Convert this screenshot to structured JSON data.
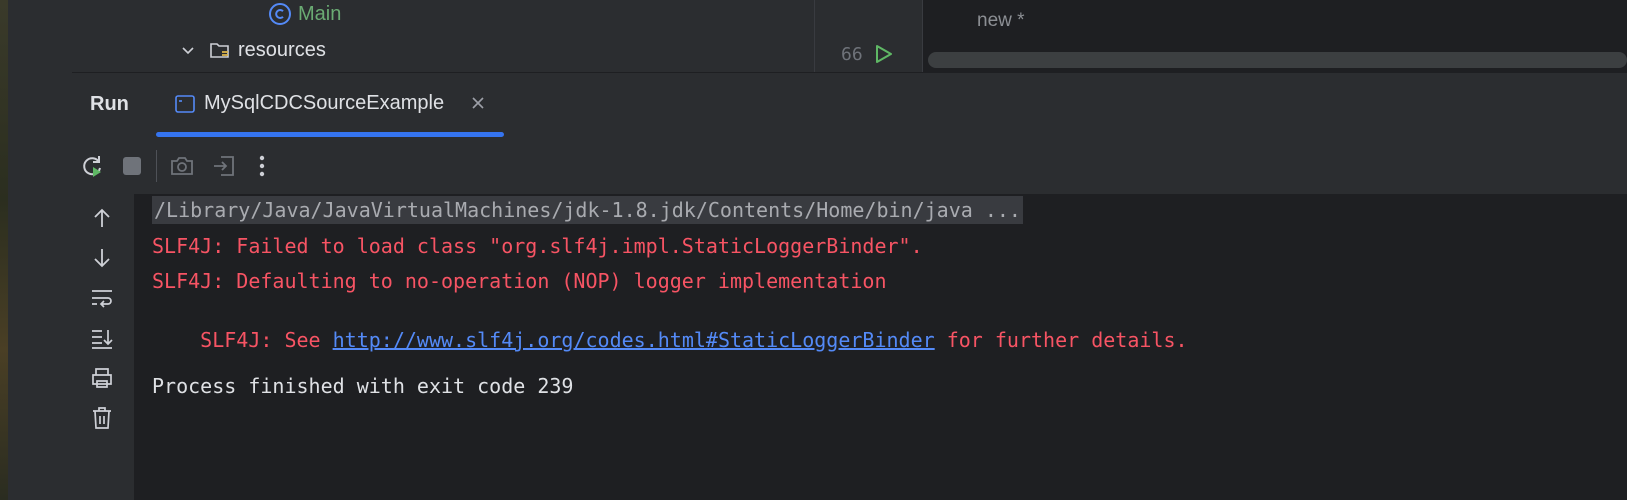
{
  "project_tree": {
    "main_class": "Main",
    "resources_folder": "resources"
  },
  "editor": {
    "line_number": "66",
    "code_fragment": "new *"
  },
  "run_window": {
    "title": "Run",
    "tab_label": "MySqlCDCSourceExample"
  },
  "console": {
    "command_line": "/Library/Java/JavaVirtualMachines/jdk-1.8.jdk/Contents/Home/bin/java ...",
    "line1": "SLF4J: Failed to load class \"org.slf4j.impl.StaticLoggerBinder\".",
    "line2": "SLF4J: Defaulting to no-operation (NOP) logger implementation",
    "line3_prefix": "SLF4J: See ",
    "line3_link": "http://www.slf4j.org/codes.html#StaticLoggerBinder",
    "line3_suffix": " for further details.",
    "exit_message": "Process finished with exit code 239"
  },
  "colors": {
    "error_text": "#f75464",
    "link": "#548af7",
    "normal_text": "#dfe1e5",
    "accent": "#3574f0",
    "run_green": "#5fb865"
  },
  "icons": {
    "class": "class-icon",
    "chevron": "chevron-down-icon",
    "folder": "resources-folder-icon",
    "run_gutter": "run-gutter-icon",
    "console_tab": "console-tab-icon",
    "close_tab": "close-icon",
    "rerun": "rerun-icon",
    "stop": "stop-icon",
    "screenshot": "camera-icon",
    "exit": "exit-icon",
    "more": "more-icon",
    "up": "arrow-up-icon",
    "down": "arrow-down-icon",
    "wrap": "soft-wrap-icon",
    "scroll_end": "scroll-to-end-icon",
    "print": "print-icon",
    "clear": "trash-icon"
  }
}
